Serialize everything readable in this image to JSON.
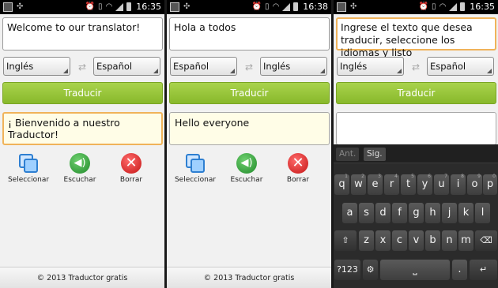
{
  "screens": [
    {
      "status": {
        "time": "16:35"
      },
      "input_text": "Welcome to our translator!",
      "source_lang": "Inglés",
      "target_lang": "Español",
      "translate_label": "Traducir",
      "output_text": "¡ Bienvenido a nuestro Traductor!",
      "actions": {
        "select": "Seleccionar",
        "listen": "Escuchar",
        "delete": "Borrar"
      },
      "footer": "© 2013 Traductor gratis"
    },
    {
      "status": {
        "time": "16:38"
      },
      "input_text": "Hola a todos",
      "source_lang": "Español",
      "target_lang": "Inglés",
      "translate_label": "Traducir",
      "output_text": "Hello everyone",
      "actions": {
        "select": "Seleccionar",
        "listen": "Escuchar",
        "delete": "Borrar"
      },
      "footer": "© 2013 Traductor gratis"
    },
    {
      "status": {
        "time": "16:35"
      },
      "input_text": "Ingrese el texto que desea traducir, seleccione los idiomas y listo",
      "source_lang": "Inglés",
      "target_lang": "Español",
      "translate_label": "Traducir",
      "output_text": "",
      "keyboard": {
        "suggest_prev": "Ant.",
        "suggest_next": "Sig.",
        "row1": [
          "q",
          "w",
          "e",
          "r",
          "t",
          "y",
          "u",
          "i",
          "o",
          "p"
        ],
        "row1_sup": [
          "1",
          "2",
          "3",
          "4",
          "5",
          "6",
          "7",
          "8",
          "9",
          "0"
        ],
        "row2": [
          "a",
          "s",
          "d",
          "f",
          "g",
          "h",
          "j",
          "k",
          "l"
        ],
        "row3": [
          "z",
          "x",
          "c",
          "v",
          "b",
          "n",
          "m"
        ],
        "mode_key": "?123",
        "shift_icon": "shift-arrow-icon",
        "backspace_icon": "backspace-icon",
        "settings_icon": "gear-icon",
        "space_icon": "space-bar-icon",
        "period": ".",
        "enter_icon": "enter-arrow-icon"
      }
    }
  ],
  "icons": {
    "select": "copy-icon",
    "listen": "speaker-icon",
    "delete": "delete-x-icon",
    "swap": "swap-arrows-icon"
  },
  "colors": {
    "translate_button": "#94c336",
    "focus_border": "#f0b35a",
    "output_bg": "#fffde7"
  }
}
